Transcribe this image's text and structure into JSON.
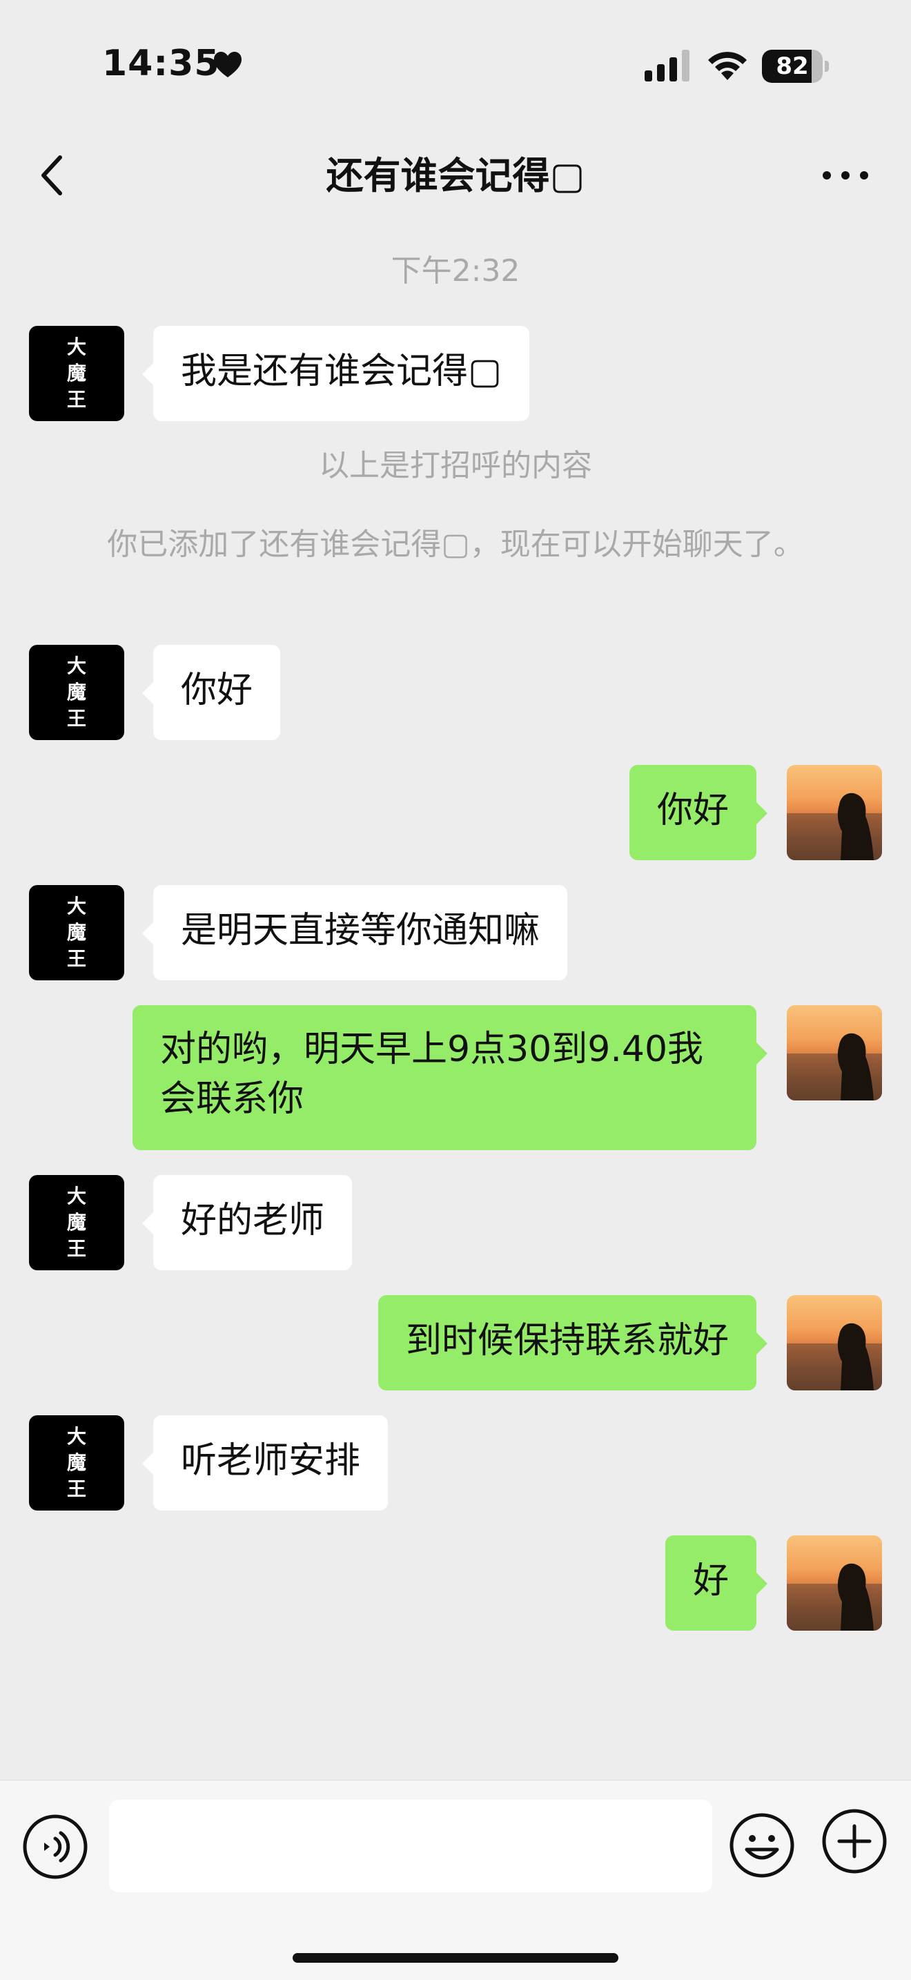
{
  "status_bar": {
    "time": "14:35",
    "battery": "82",
    "battery_level": 0.82
  },
  "header": {
    "title": "还有谁会记得▢"
  },
  "chat": {
    "timestamp": "下午2:32",
    "messages": [
      {
        "from": "contact",
        "text": "我是还有谁会记得▢"
      },
      {
        "system": "以上是打招呼的内容"
      },
      {
        "system": "你已添加了还有谁会记得▢，现在可以开始聊天了。"
      },
      {
        "from": "contact",
        "text": "你好"
      },
      {
        "from": "me",
        "text": "你好"
      },
      {
        "from": "contact",
        "text": "是明天直接等你通知嘛"
      },
      {
        "from": "me",
        "text": "对的哟，明天早上9点30到9.40我会联系你"
      },
      {
        "from": "contact",
        "text": "好的老师"
      },
      {
        "from": "me",
        "text": "到时候保持联系就好"
      },
      {
        "from": "contact",
        "text": "听老师安排"
      },
      {
        "from": "me",
        "text": "好"
      }
    ],
    "contact_avatar_text": [
      "大",
      "魔",
      "王"
    ]
  },
  "input_bar": {
    "placeholder": ""
  },
  "icons": {
    "back": "chevron-left-icon",
    "more": "more-dots-icon",
    "voice": "voice-icon",
    "emoji": "emoji-icon",
    "plus": "plus-icon"
  },
  "colors": {
    "background": "#ededed",
    "incoming_bubble": "#ffffff",
    "outgoing_bubble": "#95ec69",
    "system_text": "#a9a9a9"
  }
}
